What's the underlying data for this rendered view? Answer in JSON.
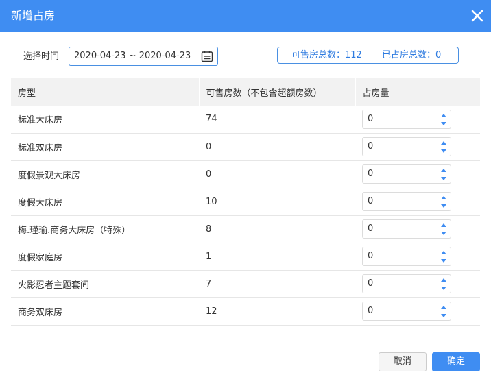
{
  "dialog": {
    "title": "新增占房",
    "close_icon": "close-icon"
  },
  "date": {
    "label": "选择时间",
    "value": "2020-04-23 ~ 2020-04-23",
    "icon": "calendar-icon"
  },
  "stats": {
    "available": "可售房总数：112",
    "occupied": "已占房总数：0"
  },
  "colors": {
    "accent": "#3f8df2",
    "header_bg": "#f2f2f2",
    "stat_text": "#2e7be0"
  },
  "table": {
    "headers": [
      "房型",
      "可售房数（不包含超额房数）",
      "占房量"
    ],
    "rows": [
      {
        "room_type": "标准大床房",
        "available": "74",
        "occupy": "0"
      },
      {
        "room_type": "标准双床房",
        "available": "0",
        "occupy": "0"
      },
      {
        "room_type": "度假景观大床房",
        "available": "0",
        "occupy": "0"
      },
      {
        "room_type": "度假大床房",
        "available": "10",
        "occupy": "0"
      },
      {
        "room_type": "梅.瑾瑜.商务大床房（特殊）",
        "available": "8",
        "occupy": "0"
      },
      {
        "room_type": "度假家庭房",
        "available": "1",
        "occupy": "0"
      },
      {
        "room_type": "火影忍者主题套间",
        "available": "7",
        "occupy": "0"
      },
      {
        "room_type": "商务双床房",
        "available": "12",
        "occupy": "0"
      }
    ]
  },
  "footer": {
    "cancel_label": "取消",
    "ok_label": "确定"
  }
}
